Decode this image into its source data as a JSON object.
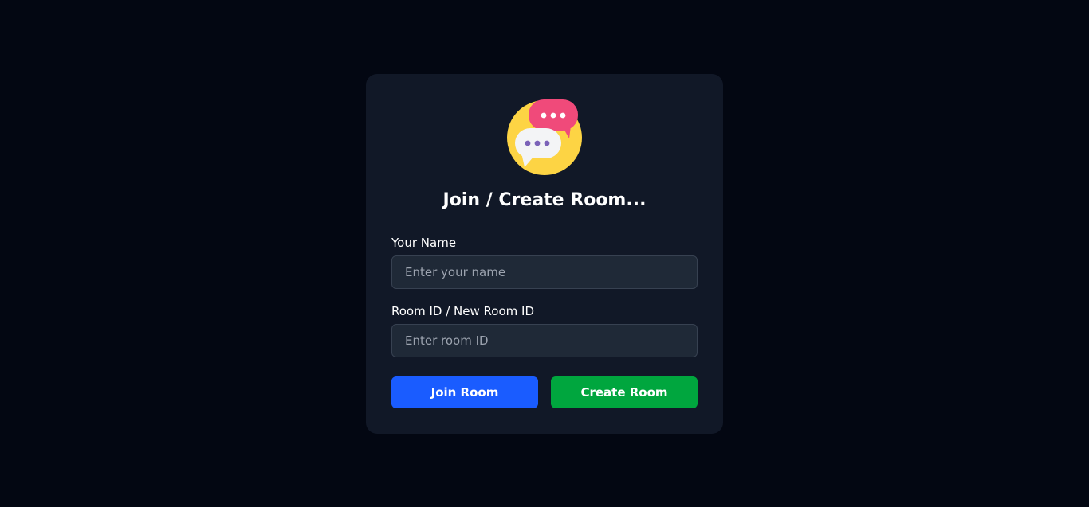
{
  "logo": {
    "icon": "chat-bubbles-icon"
  },
  "title": "Join / Create Room...",
  "name_field": {
    "label": "Your Name",
    "value": "",
    "placeholder": "Enter your name"
  },
  "room_field": {
    "label": "Room ID / New Room ID",
    "value": "",
    "placeholder": "Enter room ID"
  },
  "buttons": {
    "join_label": "Join Room",
    "create_label": "Create Room"
  },
  "colors": {
    "background": "#030712",
    "card": "#111827",
    "input_bg": "#1f2937",
    "join_button": "#1a5cff",
    "create_button": "#00a63e",
    "logo_circle": "#fdd444",
    "logo_bubble_pink": "#f04a7a",
    "logo_bubble_white": "#f3f4f6",
    "logo_dots_purple": "#7b62b8"
  }
}
